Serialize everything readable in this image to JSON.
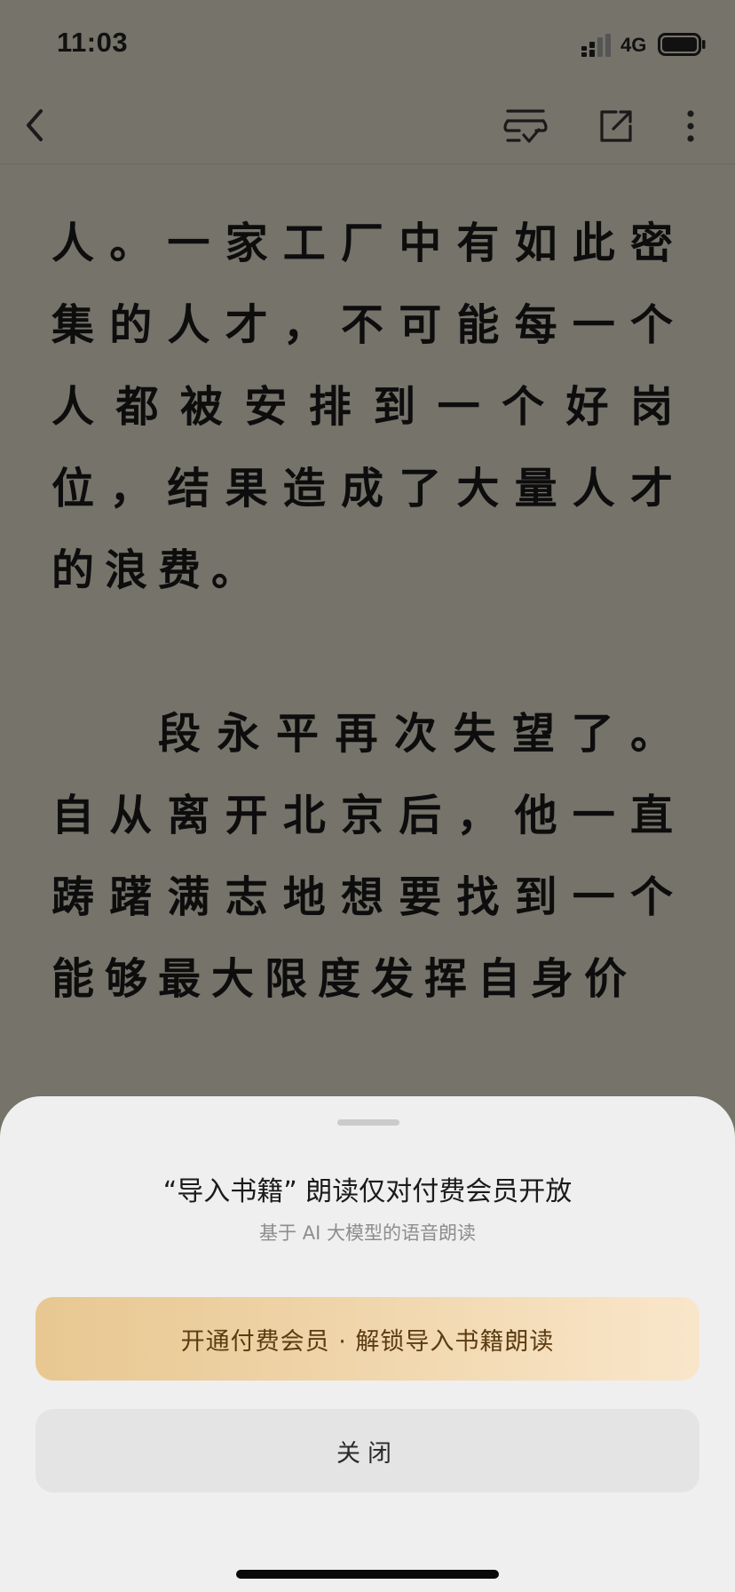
{
  "status_bar": {
    "time": "11:03",
    "network": "4G",
    "signal_icon": "cellular-signal-icon",
    "battery_icon": "battery-icon"
  },
  "nav": {
    "back_icon": "chevron-left-icon",
    "voice_icon": "voice-read-icon",
    "share_icon": "share-icon",
    "more_icon": "more-vertical-icon"
  },
  "reader": {
    "paragraphs": [
      "人。一家工厂中有如此密集的人才，不可能每一个人都被安排到一个好岗位，结果造成了大量人才的浪费。",
      "段永平再次失望了。自从离开北京后，他一直踌躇满志地想要找到一个能够最大限度发挥自身价"
    ]
  },
  "sheet": {
    "title": "“导入书籍” 朗读仅对付费会员开放",
    "subtitle": "基于 AI 大模型的语音朗读",
    "unlock_label": "开通付费会员 · 解锁导入书籍朗读",
    "close_label": "关闭"
  },
  "colors": {
    "reader_background": "#75736a",
    "reader_text": "#0d0d0d",
    "sheet_background": "#efefef",
    "unlock_gradient_start": "#e8c791",
    "unlock_gradient_end": "#f9e6ca",
    "unlock_text": "#5b3c12",
    "close_button_background": "#e4e4e4"
  }
}
